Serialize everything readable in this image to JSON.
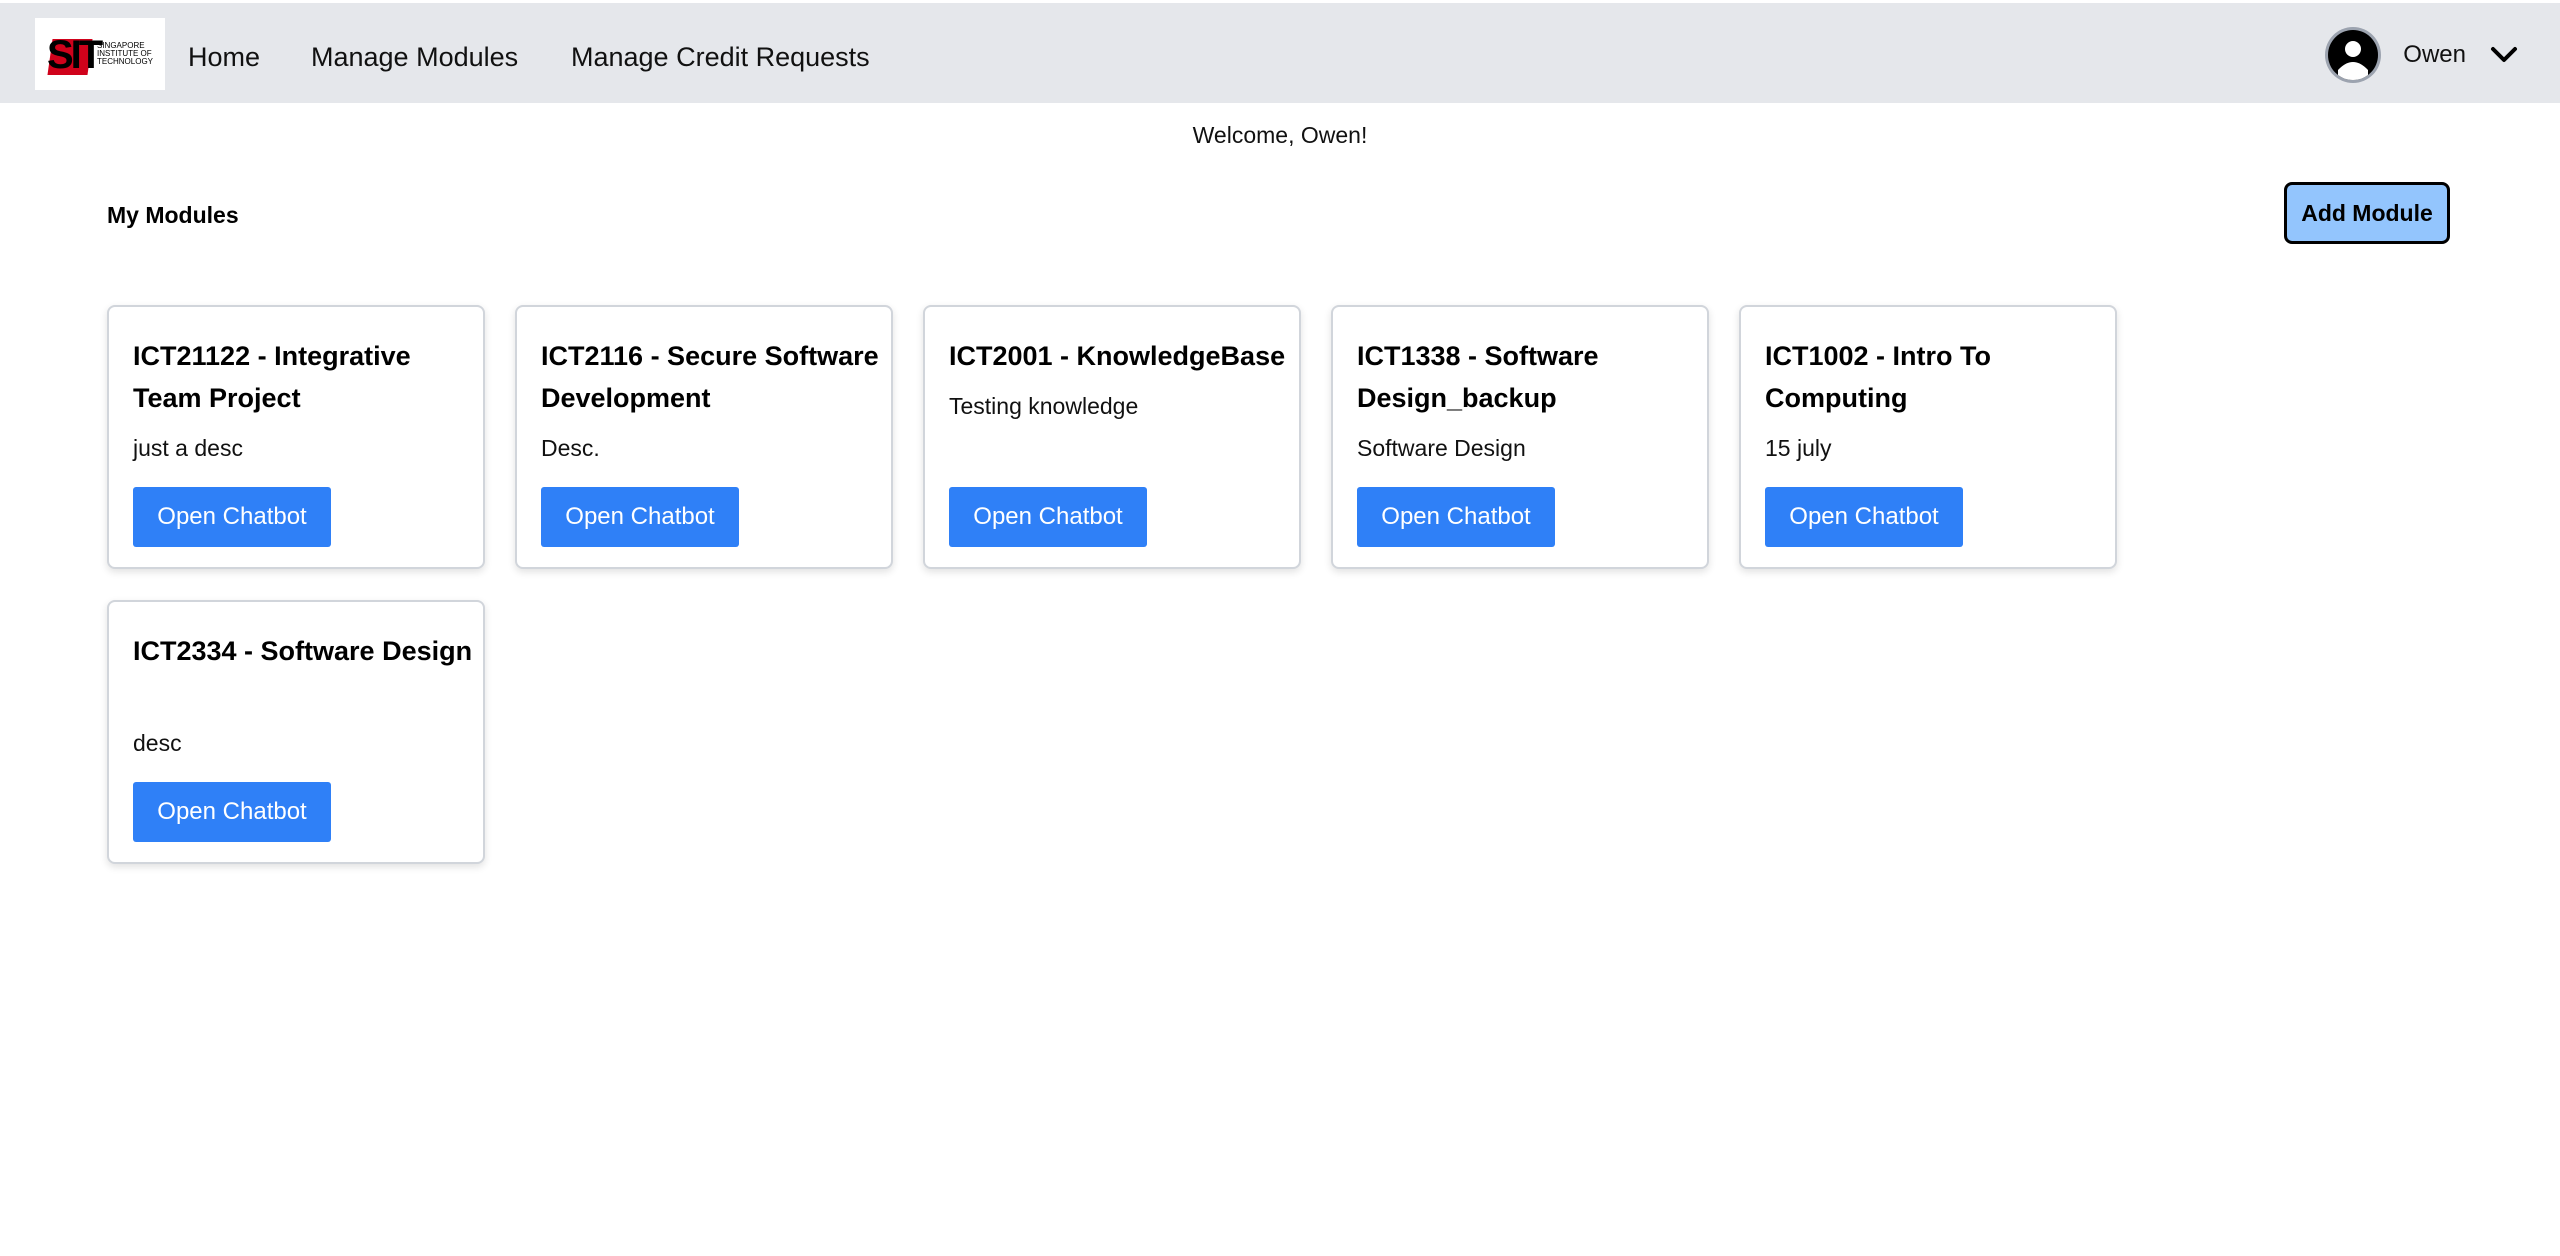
{
  "header": {
    "logo_text": "SIT",
    "logo_subtext": "SINGAPORE INSTITUTE OF TECHNOLOGY",
    "nav": [
      {
        "label": "Home"
      },
      {
        "label": "Manage Modules"
      },
      {
        "label": "Manage Credit Requests"
      }
    ],
    "user": {
      "name": "Owen",
      "avatar_icon": "user-circle-icon",
      "menu_icon": "chevron-down-icon"
    }
  },
  "main": {
    "welcome": "Welcome, Owen!",
    "section_title": "My Modules",
    "add_module_label": "Add Module",
    "modules": [
      {
        "title": "ICT21122 - Integrative Team Project",
        "description": "just a desc",
        "button": "Open Chatbot"
      },
      {
        "title": "ICT2116 - Secure Software Development",
        "description": "Desc.",
        "button": "Open Chatbot"
      },
      {
        "title": "ICT2001 - KnowledgeBase",
        "description": "Testing knowledge",
        "button": "Open Chatbot"
      },
      {
        "title": "ICT1338 - Software Design_backup",
        "description": "Software Design",
        "button": "Open Chatbot"
      },
      {
        "title": "ICT1002 - Intro To Computing",
        "description": "15 july",
        "button": "Open Chatbot"
      },
      {
        "title": "ICT2334 - Software Design",
        "description": "desc",
        "button": "Open Chatbot"
      }
    ]
  },
  "colors": {
    "header_bg": "#e5e7eb",
    "primary_button": "#2f80f7",
    "add_button": "#93c5fd"
  }
}
